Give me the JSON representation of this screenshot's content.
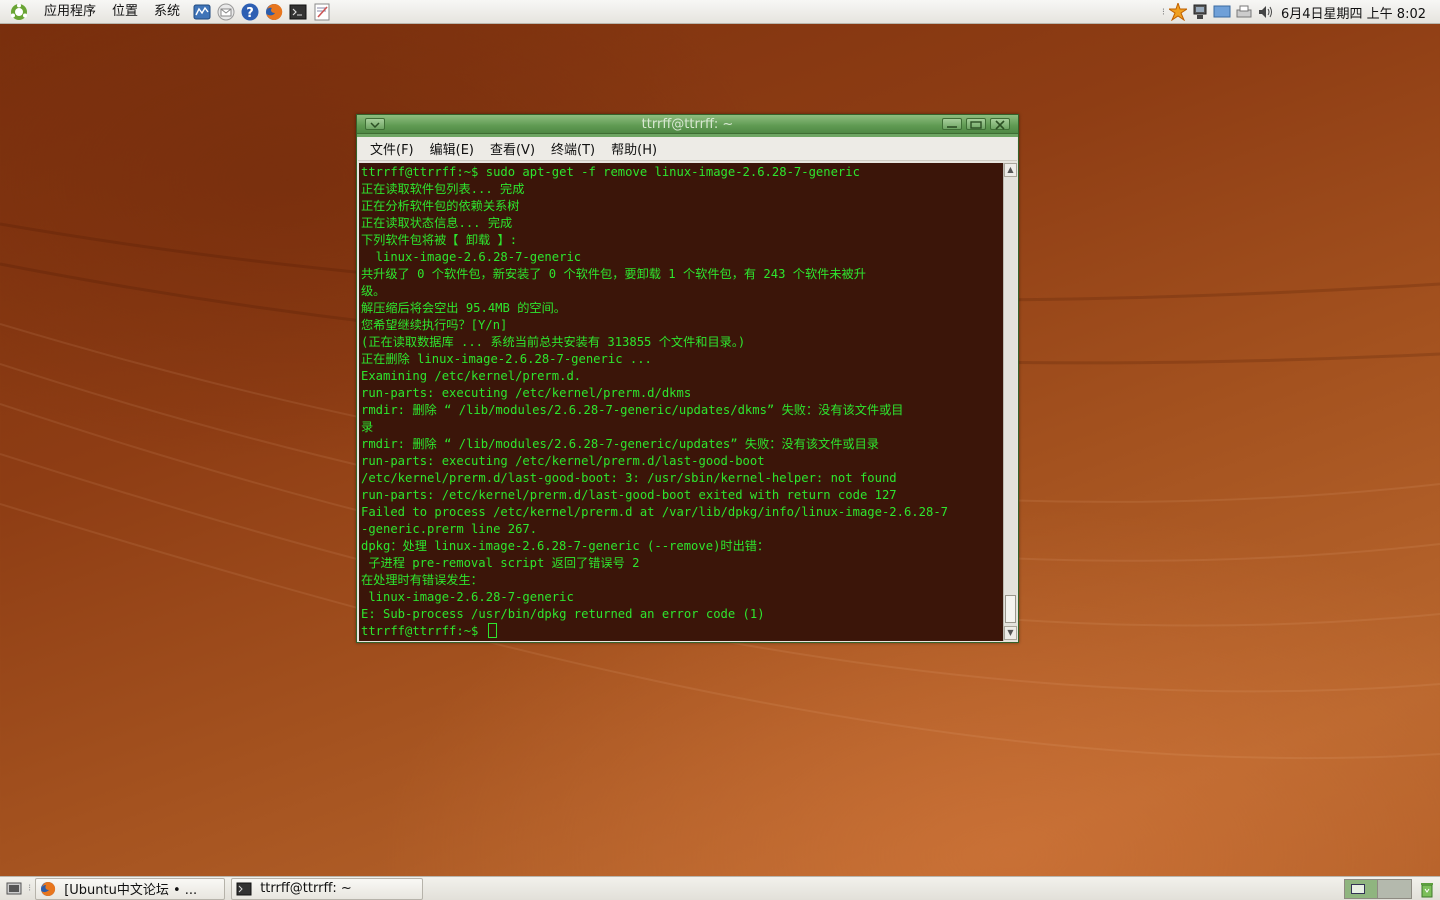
{
  "top_panel": {
    "menus": [
      "应用程序",
      "位置",
      "系统"
    ],
    "launchers": [
      "monitor-icon",
      "mail-icon",
      "help-icon",
      "firefox-icon",
      "terminal-icon",
      "edit-icon"
    ],
    "clock": "6月4日星期四 上午 8:02"
  },
  "terminal": {
    "title": "ttrrff@ttrrff: ~",
    "menu": [
      "文件(F)",
      "编辑(E)",
      "查看(V)",
      "终端(T)",
      "帮助(H)"
    ],
    "lines": [
      "ttrrff@ttrrff:~$ sudo apt-get -f remove linux-image-2.6.28-7-generic",
      "正在读取软件包列表... 完成",
      "正在分析软件包的依赖关系树",
      "正在读取状态信息... 完成",
      "下列软件包将被【 卸载 】:",
      "  linux-image-2.6.28-7-generic",
      "共升级了 0 个软件包，新安装了 0 个软件包，要卸载 1 个软件包，有 243 个软件未被升",
      "级。",
      "解压缩后将会空出 95.4MB 的空间。",
      "您希望继续执行吗？[Y/n]",
      "(正在读取数据库 ... 系统当前总共安装有 313855 个文件和目录。)",
      "正在删除 linux-image-2.6.28-7-generic ...",
      "Examining /etc/kernel/prerm.d.",
      "run-parts: executing /etc/kernel/prerm.d/dkms",
      "rmdir: 删除 “ /lib/modules/2.6.28-7-generic/updates/dkms” 失败：没有该文件或目",
      "录",
      "rmdir: 删除 “ /lib/modules/2.6.28-7-generic/updates” 失败：没有该文件或目录",
      "run-parts: executing /etc/kernel/prerm.d/last-good-boot",
      "/etc/kernel/prerm.d/last-good-boot: 3: /usr/sbin/kernel-helper: not found",
      "run-parts: /etc/kernel/prerm.d/last-good-boot exited with return code 127",
      "Failed to process /etc/kernel/prerm.d at /var/lib/dpkg/info/linux-image-2.6.28-7",
      "-generic.prerm line 267.",
      "dpkg：处理 linux-image-2.6.28-7-generic (--remove)时出错：",
      " 子进程 pre-removal script 返回了错误号 2",
      "在处理时有错误发生：",
      " linux-image-2.6.28-7-generic",
      "E: Sub-process /usr/bin/dpkg returned an error code (1)"
    ],
    "prompt": "ttrrff@ttrrff:~$ ",
    "text_color": "#2ee52e",
    "background_color": "#3b1509"
  },
  "bottom_panel": {
    "tasks": [
      {
        "label": "[Ubuntu中文论坛 • ...",
        "icon": "firefox-icon"
      },
      {
        "label": "ttrrff@ttrrff: ~",
        "icon": "terminal-icon"
      }
    ]
  }
}
